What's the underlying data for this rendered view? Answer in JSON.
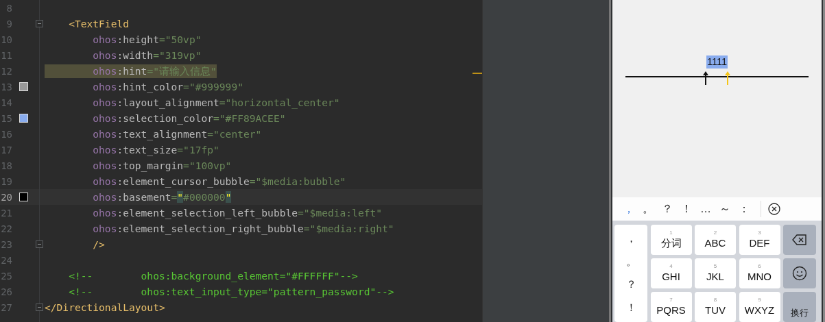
{
  "editor": {
    "lines": [
      {
        "number": "8"
      },
      {
        "number": "9",
        "foldable": true,
        "tokens": [
          {
            "kind": "tag",
            "text": "    <TextField"
          }
        ]
      },
      {
        "number": "10",
        "tokens": [
          {
            "kind": "ns",
            "text": "        ohos"
          },
          {
            "kind": "plain",
            "text": ":height"
          },
          {
            "kind": "value",
            "text": "=\"50vp\""
          }
        ]
      },
      {
        "number": "11",
        "tokens": [
          {
            "kind": "ns",
            "text": "        ohos"
          },
          {
            "kind": "plain",
            "text": ":width"
          },
          {
            "kind": "value",
            "text": "=\"319vp\""
          }
        ]
      },
      {
        "number": "12",
        "highlighted": true,
        "tokens": [
          {
            "kind": "ns",
            "text": "        ohos"
          },
          {
            "kind": "plain",
            "text": ":hint"
          },
          {
            "kind": "value",
            "text": "=\"请输入信息\""
          }
        ]
      },
      {
        "number": "13",
        "color": "#999999",
        "tokens": [
          {
            "kind": "ns",
            "text": "        ohos"
          },
          {
            "kind": "plain",
            "text": ":hint_color"
          },
          {
            "kind": "value",
            "text": "=\"#999999\""
          }
        ]
      },
      {
        "number": "14",
        "tokens": [
          {
            "kind": "ns",
            "text": "        ohos"
          },
          {
            "kind": "plain",
            "text": ":layout_alignment"
          },
          {
            "kind": "value",
            "text": "=\"horizontal_center\""
          }
        ]
      },
      {
        "number": "15",
        "color": "#89acee",
        "tokens": [
          {
            "kind": "ns",
            "text": "        ohos"
          },
          {
            "kind": "plain",
            "text": ":selection_color"
          },
          {
            "kind": "value",
            "text": "=\"#FF89ACEE\""
          }
        ]
      },
      {
        "number": "16",
        "tokens": [
          {
            "kind": "ns",
            "text": "        ohos"
          },
          {
            "kind": "plain",
            "text": ":text_alignment"
          },
          {
            "kind": "value",
            "text": "=\"center\""
          }
        ]
      },
      {
        "number": "17",
        "tokens": [
          {
            "kind": "ns",
            "text": "        ohos"
          },
          {
            "kind": "plain",
            "text": ":text_size"
          },
          {
            "kind": "value",
            "text": "=\"17fp\""
          }
        ]
      },
      {
        "number": "18",
        "tokens": [
          {
            "kind": "ns",
            "text": "        ohos"
          },
          {
            "kind": "plain",
            "text": ":top_margin"
          },
          {
            "kind": "value",
            "text": "=\"100vp\""
          }
        ]
      },
      {
        "number": "19",
        "tokens": [
          {
            "kind": "ns",
            "text": "        ohos"
          },
          {
            "kind": "plain",
            "text": ":element_cursor_bubble"
          },
          {
            "kind": "value",
            "text": "=\"$media:bubble\""
          }
        ]
      },
      {
        "number": "20",
        "current": true,
        "color": "#000000",
        "tokens": [
          {
            "kind": "ns",
            "text": "        ohos"
          },
          {
            "kind": "plain",
            "text": ":basement"
          },
          {
            "kind": "value",
            "text": "="
          },
          {
            "kind": "match",
            "text": "\""
          },
          {
            "kind": "value",
            "text": "#000000"
          },
          {
            "kind": "match",
            "text": "\""
          }
        ]
      },
      {
        "number": "21",
        "tokens": [
          {
            "kind": "ns",
            "text": "        ohos"
          },
          {
            "kind": "plain",
            "text": ":element_selection_left_bubble"
          },
          {
            "kind": "value",
            "text": "=\"$media:left\""
          }
        ]
      },
      {
        "number": "22",
        "tokens": [
          {
            "kind": "ns",
            "text": "        ohos"
          },
          {
            "kind": "plain",
            "text": ":element_selection_right_bubble"
          },
          {
            "kind": "value",
            "text": "=\"$media:right\""
          }
        ]
      },
      {
        "number": "23",
        "foldable": true,
        "tokens": [
          {
            "kind": "tag",
            "text": "        />"
          }
        ]
      },
      {
        "number": "24"
      },
      {
        "number": "25",
        "tokens": [
          {
            "kind": "comment",
            "text": "    <!--        ohos:background_element=\"#FFFFFF\"-->"
          }
        ]
      },
      {
        "number": "26",
        "tokens": [
          {
            "kind": "comment",
            "text": "    <!--        ohos:text_input_type=\"pattern_password\"-->"
          }
        ]
      },
      {
        "number": "27",
        "foldable": true,
        "tokens": [
          {
            "kind": "tag",
            "text": "</DirectionalLayout>"
          }
        ]
      }
    ]
  },
  "phone": {
    "text_field": {
      "value": "1111",
      "selected": true
    },
    "candidates": [
      {
        "text": "，",
        "selected": true
      },
      {
        "text": "。",
        "selected": false
      },
      {
        "text": "？",
        "selected": false
      },
      {
        "text": "！",
        "selected": false
      },
      {
        "text": "…",
        "selected": false
      },
      {
        "text": "～",
        "selected": false
      },
      {
        "text": "：",
        "selected": false
      }
    ],
    "punctuation_key": [
      "，",
      "。",
      "？",
      "！"
    ],
    "keys": [
      {
        "kind": "letter",
        "digit": "1",
        "label": "分词"
      },
      {
        "kind": "letter",
        "digit": "2",
        "label": "ABC"
      },
      {
        "kind": "letter",
        "digit": "3",
        "label": "DEF"
      },
      {
        "kind": "backspace"
      },
      {
        "kind": "letter",
        "digit": "4",
        "label": "GHI"
      },
      {
        "kind": "letter",
        "digit": "5",
        "label": "JKL"
      },
      {
        "kind": "letter",
        "digit": "6",
        "label": "MNO"
      },
      {
        "kind": "emoji"
      },
      {
        "kind": "letter",
        "digit": "7",
        "label": "PQRS"
      },
      {
        "kind": "letter",
        "digit": "8",
        "label": "TUV"
      },
      {
        "kind": "letter",
        "digit": "9",
        "label": "WXYZ"
      },
      {
        "kind": "enter",
        "label": "换行"
      }
    ]
  }
}
